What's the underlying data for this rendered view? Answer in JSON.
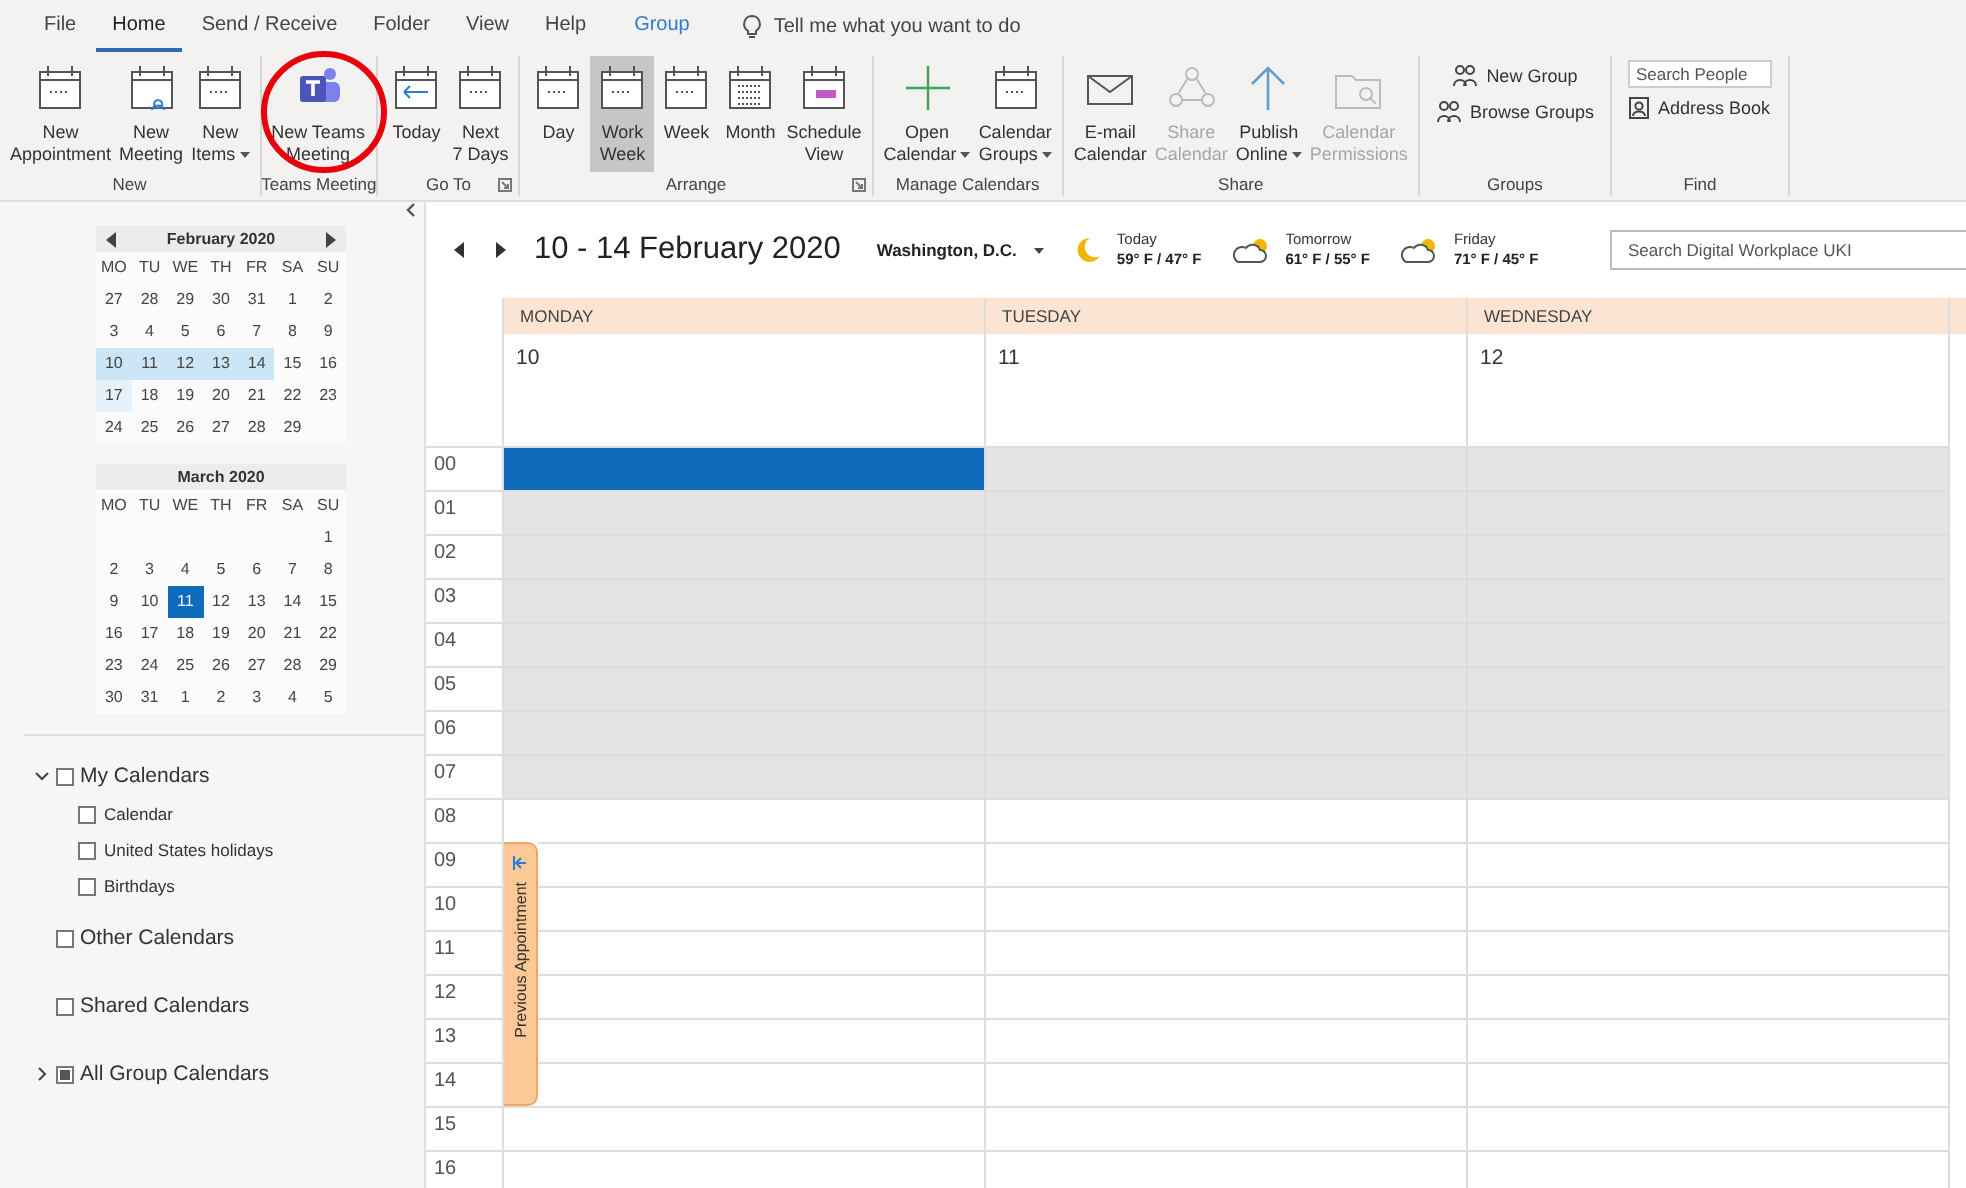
{
  "menu_tabs": [
    {
      "label": "File",
      "selected": false,
      "kind": "plain"
    },
    {
      "label": "Home",
      "selected": true,
      "kind": "plain"
    },
    {
      "label": "Send / Receive",
      "selected": false,
      "kind": "plain"
    },
    {
      "label": "Folder",
      "selected": false,
      "kind": "plain"
    },
    {
      "label": "View",
      "selected": false,
      "kind": "plain"
    },
    {
      "label": "Help",
      "selected": false,
      "kind": "plain"
    },
    {
      "label": "Group",
      "selected": false,
      "kind": "contextual"
    }
  ],
  "tell_me": {
    "placeholder": "Tell me what you want to do"
  },
  "ribbon_groups": [
    {
      "label": "New",
      "kind": "large",
      "buttons": [
        {
          "lines": [
            "New",
            "Appointment"
          ],
          "dropdown": false,
          "disabled": false,
          "selected": false
        },
        {
          "lines": [
            "New",
            "Meeting"
          ],
          "dropdown": false,
          "disabled": false,
          "selected": false
        },
        {
          "lines": [
            "New",
            "Items"
          ],
          "dropdown": true,
          "disabled": false,
          "selected": false
        }
      ]
    },
    {
      "label": "Teams Meeting",
      "kind": "large",
      "buttons": [
        {
          "lines": [
            "New Teams",
            "Meeting"
          ],
          "dropdown": false,
          "disabled": false,
          "selected": false,
          "circled": true
        }
      ]
    },
    {
      "label": "Go To",
      "kind": "large",
      "launcher": true,
      "buttons": [
        {
          "lines": [
            "Today"
          ],
          "dropdown": false,
          "disabled": false,
          "selected": false
        },
        {
          "lines": [
            "Next",
            "7 Days"
          ],
          "dropdown": false,
          "disabled": false,
          "selected": false
        }
      ]
    },
    {
      "label": "Arrange",
      "kind": "large",
      "launcher": true,
      "buttons": [
        {
          "lines": [
            "Day"
          ],
          "dropdown": false,
          "disabled": false,
          "selected": false
        },
        {
          "lines": [
            "Work",
            "Week"
          ],
          "dropdown": false,
          "disabled": false,
          "selected": true
        },
        {
          "lines": [
            "Week"
          ],
          "dropdown": false,
          "disabled": false,
          "selected": false
        },
        {
          "lines": [
            "Month"
          ],
          "dropdown": false,
          "disabled": false,
          "selected": false
        },
        {
          "lines": [
            "Schedule",
            "View"
          ],
          "dropdown": false,
          "disabled": false,
          "selected": false
        }
      ]
    },
    {
      "label": "Manage Calendars",
      "kind": "large",
      "buttons": [
        {
          "lines": [
            "Open",
            "Calendar"
          ],
          "dropdown": true,
          "disabled": false,
          "selected": false
        },
        {
          "lines": [
            "Calendar",
            "Groups"
          ],
          "dropdown": true,
          "disabled": false,
          "selected": false
        }
      ]
    },
    {
      "label": "Share",
      "kind": "large",
      "buttons": [
        {
          "lines": [
            "E-mail",
            "Calendar"
          ],
          "dropdown": false,
          "disabled": false,
          "selected": false
        },
        {
          "lines": [
            "Share",
            "Calendar"
          ],
          "dropdown": false,
          "disabled": true,
          "selected": false
        },
        {
          "lines": [
            "Publish",
            "Online"
          ],
          "dropdown": true,
          "disabled": false,
          "selected": false
        },
        {
          "lines": [
            "Calendar",
            "Permissions"
          ],
          "dropdown": false,
          "disabled": true,
          "selected": false
        }
      ]
    },
    {
      "label": "Groups",
      "kind": "small",
      "buttons": [
        {
          "lines": [
            "New Group"
          ]
        },
        {
          "lines": [
            "Browse Groups"
          ]
        }
      ]
    },
    {
      "label": "Find",
      "kind": "find",
      "search": {
        "placeholder": "Search People"
      },
      "buttons": [
        {
          "lines": [
            "Address Book"
          ]
        }
      ]
    }
  ],
  "mini_calendars": [
    {
      "title": "February 2020",
      "nav": true,
      "weekdays": [
        "MO",
        "TU",
        "WE",
        "TH",
        "FR",
        "SA",
        "SU"
      ],
      "weeks": [
        [
          {
            "d": "27",
            "kind": "plain"
          },
          {
            "d": "28",
            "kind": "plain"
          },
          {
            "d": "29",
            "kind": "plain"
          },
          {
            "d": "30",
            "kind": "plain"
          },
          {
            "d": "31",
            "kind": "plain"
          },
          {
            "d": "1",
            "kind": "plain"
          },
          {
            "d": "2",
            "kind": "plain"
          }
        ],
        [
          {
            "d": "3",
            "kind": "plain"
          },
          {
            "d": "4",
            "kind": "plain"
          },
          {
            "d": "5",
            "kind": "plain"
          },
          {
            "d": "6",
            "kind": "plain"
          },
          {
            "d": "7",
            "kind": "plain"
          },
          {
            "d": "8",
            "kind": "plain"
          },
          {
            "d": "9",
            "kind": "plain"
          }
        ],
        [
          {
            "d": "10",
            "kind": "range"
          },
          {
            "d": "11",
            "kind": "range"
          },
          {
            "d": "12",
            "kind": "range"
          },
          {
            "d": "13",
            "kind": "range"
          },
          {
            "d": "14",
            "kind": "range"
          },
          {
            "d": "15",
            "kind": "plain"
          },
          {
            "d": "16",
            "kind": "plain"
          }
        ],
        [
          {
            "d": "17",
            "kind": "hover"
          },
          {
            "d": "18",
            "kind": "plain"
          },
          {
            "d": "19",
            "kind": "plain"
          },
          {
            "d": "20",
            "kind": "plain"
          },
          {
            "d": "21",
            "kind": "plain"
          },
          {
            "d": "22",
            "kind": "plain"
          },
          {
            "d": "23",
            "kind": "plain"
          }
        ],
        [
          {
            "d": "24",
            "kind": "plain"
          },
          {
            "d": "25",
            "kind": "plain"
          },
          {
            "d": "26",
            "kind": "plain"
          },
          {
            "d": "27",
            "kind": "plain"
          },
          {
            "d": "28",
            "kind": "plain"
          },
          {
            "d": "29",
            "kind": "plain"
          }
        ]
      ]
    },
    {
      "title": "March 2020",
      "weekdays": [
        "MO",
        "TU",
        "WE",
        "TH",
        "FR",
        "SA",
        "SU"
      ],
      "weeks": [
        [
          {
            "d": "1",
            "kind": "plain"
          }
        ],
        [
          {
            "d": "2",
            "kind": "plain"
          },
          {
            "d": "3",
            "kind": "plain"
          },
          {
            "d": "4",
            "kind": "plain"
          },
          {
            "d": "5",
            "kind": "plain"
          },
          {
            "d": "6",
            "kind": "plain"
          },
          {
            "d": "7",
            "kind": "plain"
          },
          {
            "d": "8",
            "kind": "plain"
          }
        ],
        [
          {
            "d": "9",
            "kind": "plain"
          },
          {
            "d": "10",
            "kind": "plain"
          },
          {
            "d": "11",
            "kind": "today"
          },
          {
            "d": "12",
            "kind": "plain"
          },
          {
            "d": "13",
            "kind": "plain"
          },
          {
            "d": "14",
            "kind": "plain"
          },
          {
            "d": "15",
            "kind": "plain"
          }
        ],
        [
          {
            "d": "16",
            "kind": "plain"
          },
          {
            "d": "17",
            "kind": "plain"
          },
          {
            "d": "18",
            "kind": "plain"
          },
          {
            "d": "19",
            "kind": "plain"
          },
          {
            "d": "20",
            "kind": "plain"
          },
          {
            "d": "21",
            "kind": "plain"
          },
          {
            "d": "22",
            "kind": "plain"
          }
        ],
        [
          {
            "d": "23",
            "kind": "plain"
          },
          {
            "d": "24",
            "kind": "plain"
          },
          {
            "d": "25",
            "kind": "plain"
          },
          {
            "d": "26",
            "kind": "plain"
          },
          {
            "d": "27",
            "kind": "plain"
          },
          {
            "d": "28",
            "kind": "plain"
          },
          {
            "d": "29",
            "kind": "plain"
          }
        ],
        [
          {
            "d": "30",
            "kind": "plain"
          },
          {
            "d": "31",
            "kind": "plain"
          },
          {
            "d": "1",
            "kind": "plain"
          },
          {
            "d": "2",
            "kind": "plain"
          },
          {
            "d": "3",
            "kind": "plain"
          },
          {
            "d": "4",
            "kind": "plain"
          },
          {
            "d": "5",
            "kind": "plain"
          }
        ]
      ]
    }
  ],
  "folders": [
    {
      "label": "My Calendars",
      "checked": false,
      "expanded": true,
      "children": [
        {
          "label": "Calendar",
          "checked": false
        },
        {
          "label": "United States holidays",
          "checked": false
        },
        {
          "label": "Birthdays",
          "checked": false
        }
      ]
    },
    {
      "label": "Other Calendars",
      "checked": false
    },
    {
      "label": "Shared Calendars",
      "checked": false
    },
    {
      "label": "All Group Calendars",
      "checked": true,
      "expanded": false
    }
  ],
  "calendar": {
    "title": "10 - 14 February 2020",
    "location": "Washington, D.C.",
    "weather": [
      {
        "day": "Today",
        "temps": "59° F / 47° F",
        "kind": "moon"
      },
      {
        "day": "Tomorrow",
        "temps": "61° F / 55° F",
        "kind": "partly-cloudy"
      },
      {
        "day": "Friday",
        "temps": "71° F / 45° F",
        "kind": "partly-cloudy"
      }
    ],
    "search": {
      "placeholder": "Search Digital Workplace UKI"
    },
    "days": [
      {
        "name": "MONDAY",
        "date": "10"
      },
      {
        "name": "TUESDAY",
        "date": "11"
      },
      {
        "name": "WEDNESDAY",
        "date": "12"
      }
    ],
    "hours": [
      {
        "label": "00",
        "work": false,
        "selected": true
      },
      {
        "label": "01",
        "work": false,
        "selected": false
      },
      {
        "label": "02",
        "work": false,
        "selected": false
      },
      {
        "label": "03",
        "work": false,
        "selected": false
      },
      {
        "label": "04",
        "work": false,
        "selected": false
      },
      {
        "label": "05",
        "work": false,
        "selected": false
      },
      {
        "label": "06",
        "work": false,
        "selected": false
      },
      {
        "label": "07",
        "work": false,
        "selected": false
      },
      {
        "label": "08",
        "work": true,
        "selected": false
      },
      {
        "label": "09",
        "work": true,
        "selected": false
      },
      {
        "label": "10",
        "work": true,
        "selected": false
      },
      {
        "label": "11",
        "work": true,
        "selected": false
      },
      {
        "label": "12",
        "work": true,
        "selected": false
      },
      {
        "label": "13",
        "work": true,
        "selected": false
      },
      {
        "label": "14",
        "work": true,
        "selected": false
      },
      {
        "label": "15",
        "work": true,
        "selected": false
      },
      {
        "label": "16",
        "work": true,
        "selected": false
      }
    ],
    "previous_appointment": {
      "label": "Previous Appointment"
    }
  }
}
